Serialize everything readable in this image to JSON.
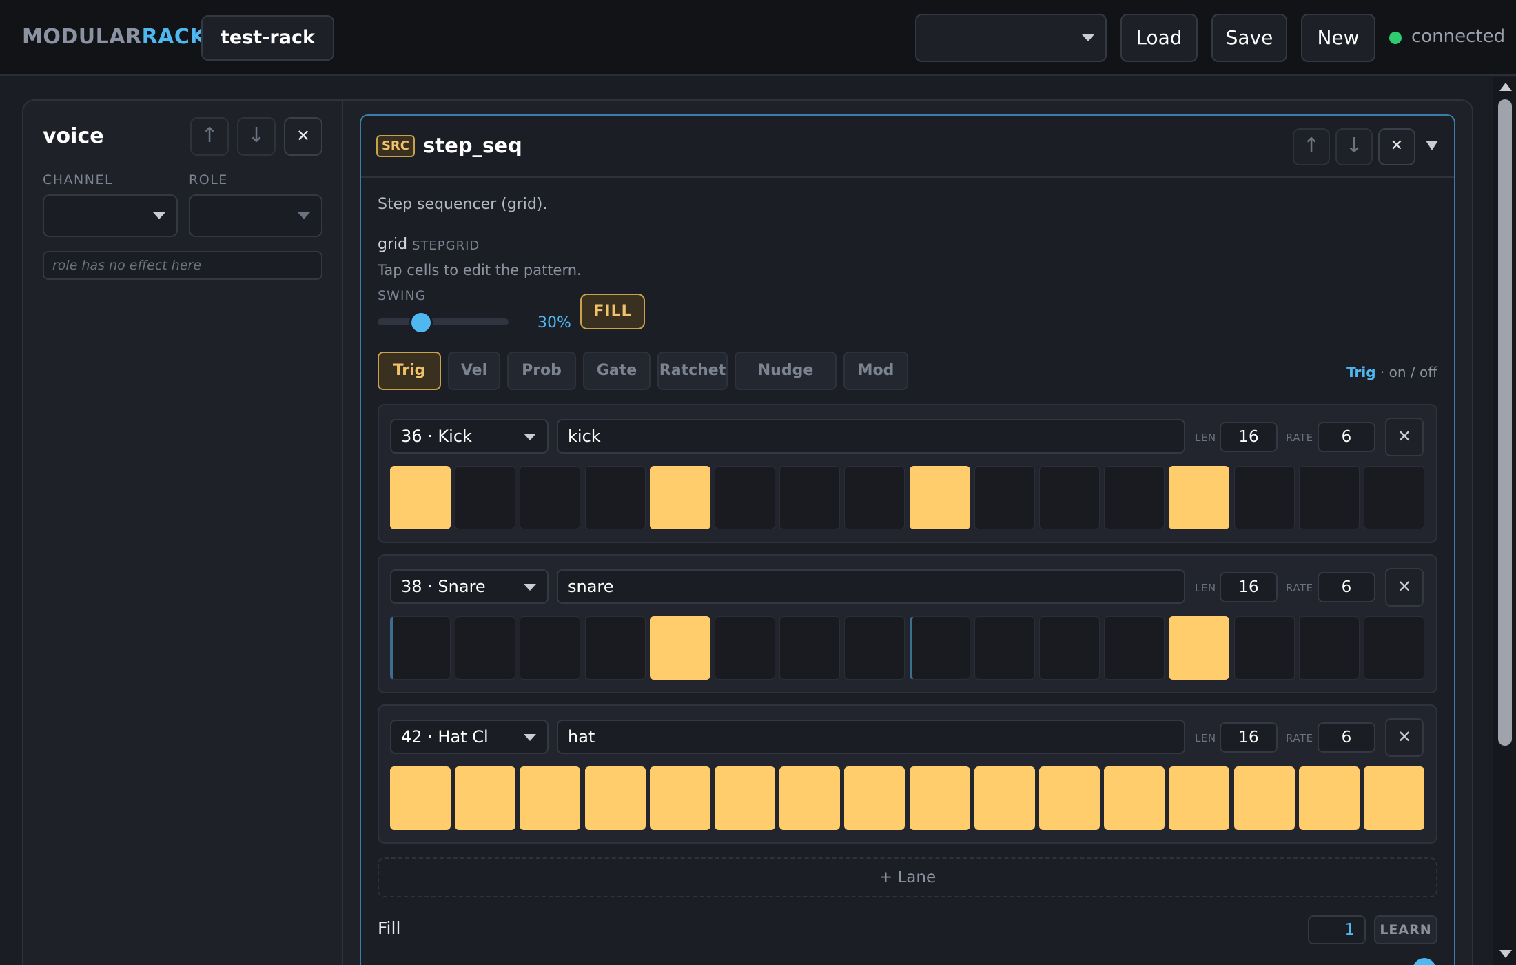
{
  "header": {
    "brand_part1": "MODULAR",
    "brand_part2": "RACK",
    "rack_name": "test-rack",
    "preset_value": "",
    "load_label": "Load",
    "save_label": "Save",
    "new_label": "New",
    "status": "connected",
    "status_color": "#2ecc71"
  },
  "voice": {
    "title": "voice",
    "channel_label": "CHANNEL",
    "role_label": "ROLE",
    "channel_value": "",
    "role_value": "",
    "role_hint": "role has no effect here"
  },
  "module": {
    "badge": "SRC",
    "title": "step_seq",
    "description": "Step sequencer (grid).",
    "param_name": "grid",
    "param_type": "STEPGRID",
    "param_hint": "Tap cells to edit the pattern.",
    "swing_label": "SWING",
    "swing_value": "30%",
    "swing_fraction": 0.3,
    "fill_button": "FILL",
    "tabs": [
      {
        "label": "Trig",
        "active": true
      },
      {
        "label": "Vel",
        "active": false
      },
      {
        "label": "Prob",
        "active": false
      },
      {
        "label": "Gate",
        "active": false
      },
      {
        "label": "Ratchet",
        "active": false
      },
      {
        "label": "Nudge",
        "active": false
      },
      {
        "label": "Mod",
        "active": false
      }
    ],
    "mode_name": "Trig",
    "mode_desc": " · on / off",
    "len_label": "LEN",
    "rate_label": "RATE",
    "lanes": [
      {
        "note": "36 · Kick",
        "name": "kick",
        "len": "16",
        "rate": "6",
        "steps": [
          1,
          0,
          0,
          0,
          1,
          0,
          0,
          0,
          1,
          0,
          0,
          0,
          1,
          0,
          0,
          0
        ]
      },
      {
        "note": "38 · Snare",
        "name": "snare",
        "len": "16",
        "rate": "6",
        "steps": [
          0,
          0,
          0,
          0,
          1,
          0,
          0,
          0,
          0,
          0,
          0,
          0,
          1,
          0,
          0,
          0
        ]
      },
      {
        "note": "42 · Hat Cl",
        "name": "hat",
        "len": "16",
        "rate": "6",
        "steps": [
          1,
          1,
          1,
          1,
          1,
          1,
          1,
          1,
          1,
          1,
          1,
          1,
          1,
          1,
          1,
          1
        ]
      }
    ],
    "add_lane_label": "+ Lane",
    "fill_row_label": "Fill",
    "fill_value": "1",
    "learn_label": "LEARN",
    "step_on_color": "#ffcd6b",
    "accent_color": "#4fb8f0"
  }
}
